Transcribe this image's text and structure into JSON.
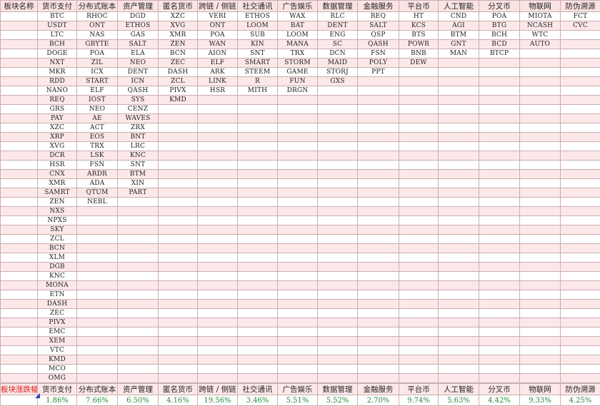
{
  "header": {
    "row_label": "板块名称",
    "columns": [
      "货币支付",
      "分布式账本",
      "资产管理",
      "匿名货币",
      "跨链 / 侧链",
      "社交通讯",
      "广告娱乐",
      "数据管理",
      "金融服务",
      "平台币",
      "人工智能",
      "分叉币",
      "物联网",
      "防伪溯源"
    ]
  },
  "table": {
    "rows": [
      [
        "BTC",
        "RHOC",
        "DGD",
        "XZC",
        "VERI",
        "ETHOS",
        "WAX",
        "RLC",
        "REQ",
        "HT",
        "CND",
        "POA",
        "MIOTA",
        "FCT"
      ],
      [
        "USDT",
        "ONT",
        "ETHOS",
        "XVG",
        "ONT",
        "LOOM",
        "BAT",
        "DENT",
        "SALT",
        "KCS",
        "AGI",
        "BTG",
        "NCASH",
        "CVC"
      ],
      [
        "LTC",
        "NAS",
        "GAS",
        "XMR",
        "POA",
        "SUB",
        "LOOM",
        "ENG",
        "QSP",
        "BTS",
        "BTM",
        "BCH",
        "WTC",
        ""
      ],
      [
        "BCH",
        "GBYTE",
        "SALT",
        "ZEN",
        "WAN",
        "KIN",
        "MANA",
        "SC",
        "QASH",
        "POWR",
        "GNT",
        "BCD",
        "AUTO",
        ""
      ],
      [
        "DOGE",
        "POA",
        "ELA",
        "BCN",
        "AION",
        "SNT",
        "TRX",
        "DCN",
        "FSN",
        "BNB",
        "MAN",
        "BTCP",
        "",
        ""
      ],
      [
        "NXT",
        "ZIL",
        "NEO",
        "ZEC",
        "ELF",
        "SMART",
        "STORM",
        "MAID",
        "POLY",
        "DEW",
        "",
        "",
        "",
        ""
      ],
      [
        "MKR",
        "ICX",
        "DENT",
        "DASH",
        "ARK",
        "STEEM",
        "GAME",
        "STORJ",
        "PPT",
        "",
        "",
        "",
        "",
        ""
      ],
      [
        "RDD",
        "START",
        "ICN",
        "ZCL",
        "LINK",
        "R",
        "FUN",
        "GXS",
        "",
        "",
        "",
        "",
        "",
        ""
      ],
      [
        "NANO",
        "ELF",
        "QASH",
        "PIVX",
        "HSR",
        "MITH",
        "DRGN",
        "",
        "",
        "",
        "",
        "",
        "",
        ""
      ],
      [
        "REQ",
        "IOST",
        "SYS",
        "KMD",
        "",
        "",
        "",
        "",
        "",
        "",
        "",
        "",
        "",
        ""
      ],
      [
        "GRS",
        "NEO",
        "CENZ",
        "",
        "",
        "",
        "",
        "",
        "",
        "",
        "",
        "",
        "",
        ""
      ],
      [
        "PAY",
        "AE",
        "WAVES",
        "",
        "",
        "",
        "",
        "",
        "",
        "",
        "",
        "",
        "",
        ""
      ],
      [
        "XZC",
        "ACT",
        "ZRX",
        "",
        "",
        "",
        "",
        "",
        "",
        "",
        "",
        "",
        "",
        ""
      ],
      [
        "XRP",
        "EOS",
        "BNT",
        "",
        "",
        "",
        "",
        "",
        "",
        "",
        "",
        "",
        "",
        ""
      ],
      [
        "XVG",
        "TRX",
        "LRC",
        "",
        "",
        "",
        "",
        "",
        "",
        "",
        "",
        "",
        "",
        ""
      ],
      [
        "DCR",
        "LSK",
        "KNC",
        "",
        "",
        "",
        "",
        "",
        "",
        "",
        "",
        "",
        "",
        ""
      ],
      [
        "HSR",
        "FSN",
        "SNT",
        "",
        "",
        "",
        "",
        "",
        "",
        "",
        "",
        "",
        "",
        ""
      ],
      [
        "CNX",
        "ARDR",
        "BTM",
        "",
        "",
        "",
        "",
        "",
        "",
        "",
        "",
        "",
        "",
        ""
      ],
      [
        "XMR",
        "ADA",
        "XIN",
        "",
        "",
        "",
        "",
        "",
        "",
        "",
        "",
        "",
        "",
        ""
      ],
      [
        "SAMRT",
        "QTUM",
        "PART",
        "",
        "",
        "",
        "",
        "",
        "",
        "",
        "",
        "",
        "",
        ""
      ],
      [
        "ZEN",
        "NEBL",
        "",
        "",
        "",
        "",
        "",
        "",
        "",
        "",
        "",
        "",
        "",
        ""
      ],
      [
        "NXS",
        "",
        "",
        "",
        "",
        "",
        "",
        "",
        "",
        "",
        "",
        "",
        "",
        ""
      ],
      [
        "NPXS",
        "",
        "",
        "",
        "",
        "",
        "",
        "",
        "",
        "",
        "",
        "",
        "",
        ""
      ],
      [
        "SKY",
        "",
        "",
        "",
        "",
        "",
        "",
        "",
        "",
        "",
        "",
        "",
        "",
        ""
      ],
      [
        "ZCL",
        "",
        "",
        "",
        "",
        "",
        "",
        "",
        "",
        "",
        "",
        "",
        "",
        ""
      ],
      [
        "BCN",
        "",
        "",
        "",
        "",
        "",
        "",
        "",
        "",
        "",
        "",
        "",
        "",
        ""
      ],
      [
        "XLM",
        "",
        "",
        "",
        "",
        "",
        "",
        "",
        "",
        "",
        "",
        "",
        "",
        ""
      ],
      [
        "DGB",
        "",
        "",
        "",
        "",
        "",
        "",
        "",
        "",
        "",
        "",
        "",
        "",
        ""
      ],
      [
        "KNC",
        "",
        "",
        "",
        "",
        "",
        "",
        "",
        "",
        "",
        "",
        "",
        "",
        ""
      ],
      [
        "MONA",
        "",
        "",
        "",
        "",
        "",
        "",
        "",
        "",
        "",
        "",
        "",
        "",
        ""
      ],
      [
        "ETN",
        "",
        "",
        "",
        "",
        "",
        "",
        "",
        "",
        "",
        "",
        "",
        "",
        ""
      ],
      [
        "DASH",
        "",
        "",
        "",
        "",
        "",
        "",
        "",
        "",
        "",
        "",
        "",
        "",
        ""
      ],
      [
        "ZEC",
        "",
        "",
        "",
        "",
        "",
        "",
        "",
        "",
        "",
        "",
        "",
        "",
        ""
      ],
      [
        "PIVX",
        "",
        "",
        "",
        "",
        "",
        "",
        "",
        "",
        "",
        "",
        "",
        "",
        ""
      ],
      [
        "EMC",
        "",
        "",
        "",
        "",
        "",
        "",
        "",
        "",
        "",
        "",
        "",
        "",
        ""
      ],
      [
        "XEM",
        "",
        "",
        "",
        "",
        "",
        "",
        "",
        "",
        "",
        "",
        "",
        "",
        ""
      ],
      [
        "VTC",
        "",
        "",
        "",
        "",
        "",
        "",
        "",
        "",
        "",
        "",
        "",
        "",
        ""
      ],
      [
        "KMD",
        "",
        "",
        "",
        "",
        "",
        "",
        "",
        "",
        "",
        "",
        "",
        "",
        ""
      ],
      [
        "MCO",
        "",
        "",
        "",
        "",
        "",
        "",
        "",
        "",
        "",
        "",
        "",
        "",
        ""
      ],
      [
        "OMG",
        "",
        "",
        "",
        "",
        "",
        "",
        "",
        "",
        "",
        "",
        "",
        "",
        ""
      ]
    ]
  },
  "summary": {
    "label": "板块涨跌幅",
    "values": [
      "1.86%",
      "7.66%",
      "6.50%",
      "4.16%",
      "19.56%",
      "3.46%",
      "5.51%",
      "5.52%",
      "2.70%",
      "9.74%",
      "5.63%",
      "4.42%",
      "9.33%",
      "4.25%"
    ]
  },
  "colors": {
    "header_bg": "#fbe3e4",
    "stripe_bg": "#fce8e8",
    "grid": "#c9aeb2",
    "summary_label": "#cc1f1f",
    "positive": "#2a8a3a",
    "marker": "#2b45b8"
  }
}
